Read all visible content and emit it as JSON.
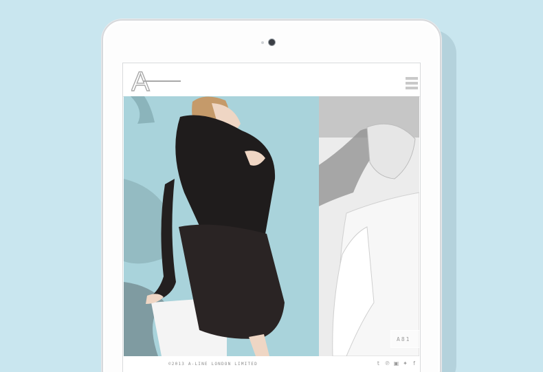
{
  "brand": {
    "logo_letter": "A"
  },
  "nav": {
    "menu_icon": "hamburger-icon"
  },
  "gallery": {
    "right_panel_button": "A81"
  },
  "footer": {
    "copyright": "©2013 A-LINE LONDON LIMITED",
    "social": [
      {
        "name": "tumblr-icon",
        "glyph": "t"
      },
      {
        "name": "pinterest-icon",
        "glyph": "℗"
      },
      {
        "name": "instagram-icon",
        "glyph": "▣"
      },
      {
        "name": "twitter-icon",
        "glyph": "✦"
      },
      {
        "name": "facebook-icon",
        "glyph": "f"
      }
    ]
  },
  "colors": {
    "background": "#c9e6ef",
    "left_panel": "#a9d3db",
    "right_panel": "#d4d4d4"
  }
}
